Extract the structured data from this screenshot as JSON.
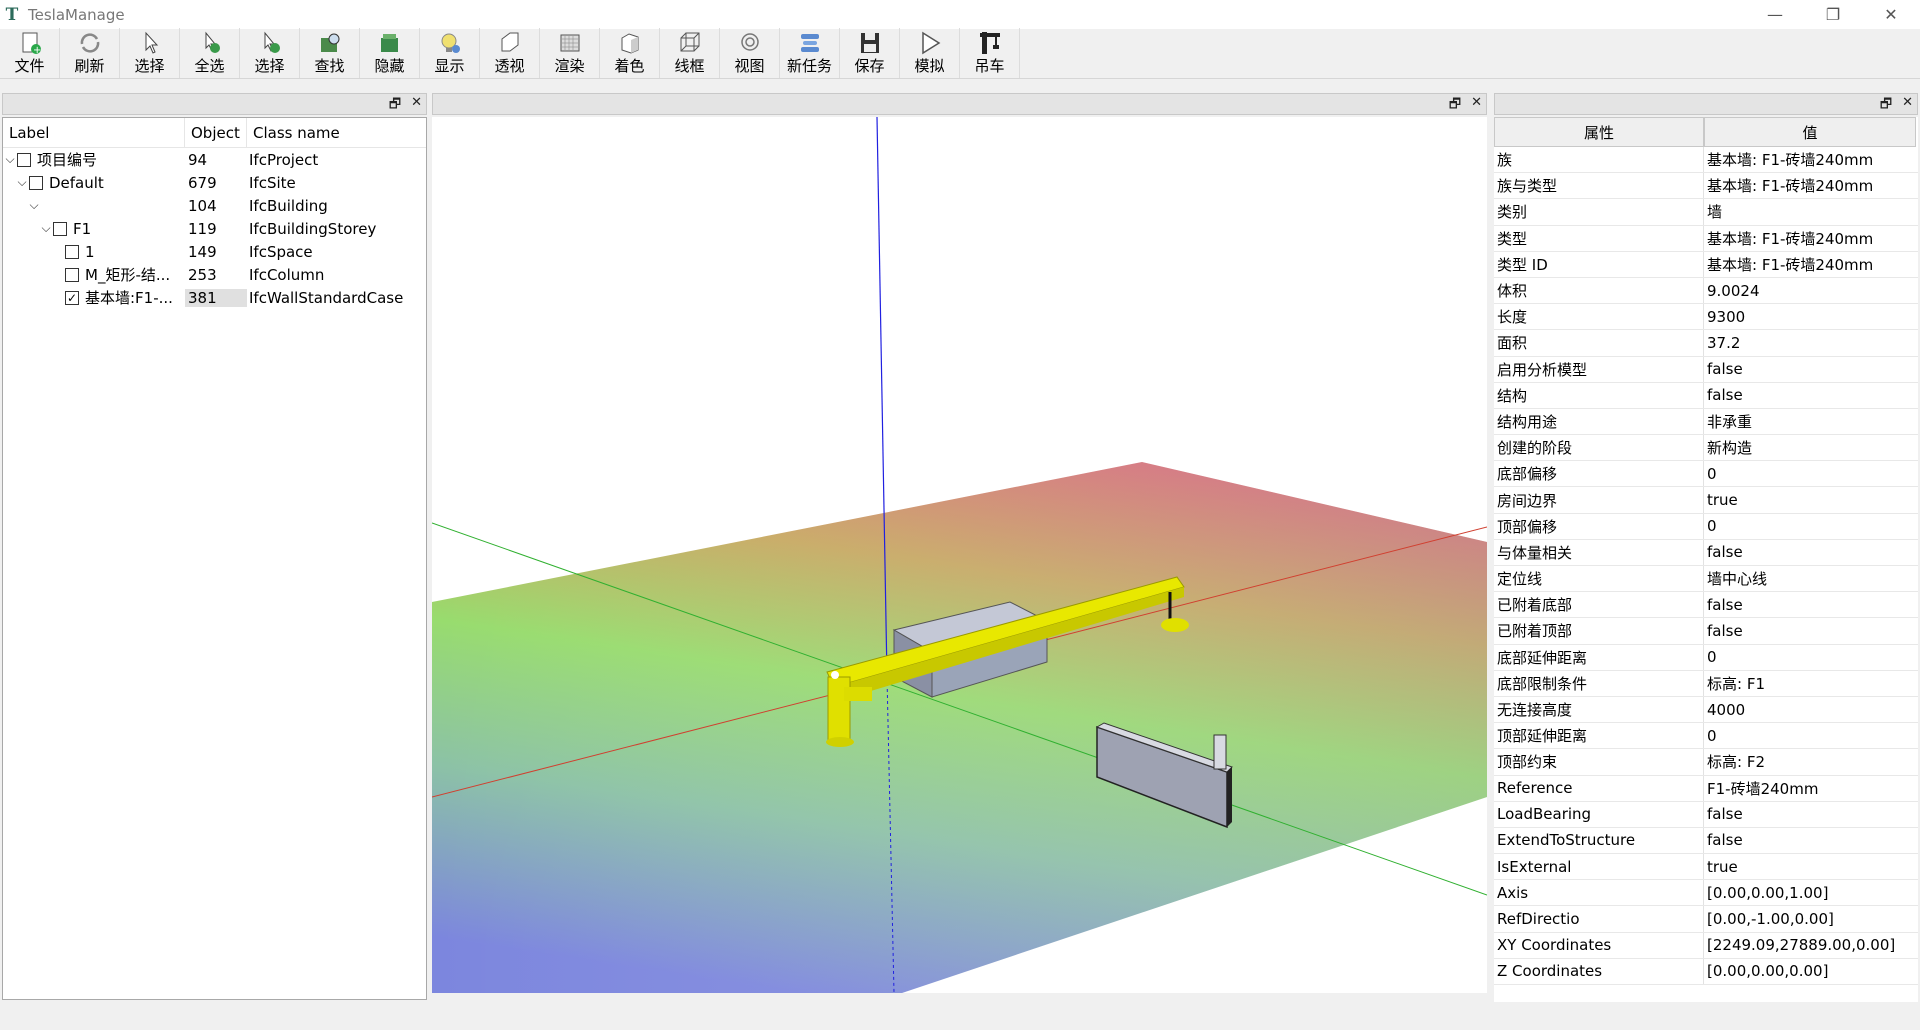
{
  "app": {
    "title": "TeslaManage",
    "logo_letter": "T"
  },
  "window_controls": {
    "minimize": "—",
    "restore": "❐",
    "close": "✕"
  },
  "toolbar": [
    {
      "label": "文件",
      "icon": "new-file-icon"
    },
    {
      "label": "刷新",
      "icon": "refresh-icon"
    },
    {
      "label": "选择",
      "icon": "cursor-icon"
    },
    {
      "label": "全选",
      "icon": "select-all-icon"
    },
    {
      "label": "选择",
      "icon": "select-icon"
    },
    {
      "label": "查找",
      "icon": "find-icon"
    },
    {
      "label": "隐藏",
      "icon": "hide-icon"
    },
    {
      "label": "显示",
      "icon": "show-icon"
    },
    {
      "label": "透视",
      "icon": "perspective-icon"
    },
    {
      "label": "渲染",
      "icon": "render-icon"
    },
    {
      "label": "着色",
      "icon": "shade-icon"
    },
    {
      "label": "线框",
      "icon": "wireframe-icon"
    },
    {
      "label": "视图",
      "icon": "view-icon"
    },
    {
      "label": "新任务",
      "icon": "new-task-icon"
    },
    {
      "label": "保存",
      "icon": "save-icon"
    },
    {
      "label": "模拟",
      "icon": "simulate-icon"
    },
    {
      "label": "吊车",
      "icon": "crane-icon"
    }
  ],
  "dock_buttons": {
    "float": "🗗",
    "close": "✕"
  },
  "tree": {
    "headers": {
      "label": "Label",
      "object": "Object",
      "class": "Class name"
    },
    "rows": [
      {
        "indent": 0,
        "expander": "⌵",
        "checkbox": true,
        "checked": false,
        "label": "项目编号",
        "object": "94",
        "class": "IfcProject"
      },
      {
        "indent": 1,
        "expander": "⌵",
        "checkbox": true,
        "checked": false,
        "label": "Default",
        "object": "679",
        "class": "IfcSite"
      },
      {
        "indent": 2,
        "expander": "⌵",
        "checkbox": false,
        "checked": false,
        "label": "",
        "object": "104",
        "class": "IfcBuilding"
      },
      {
        "indent": 3,
        "expander": "⌵",
        "checkbox": true,
        "checked": false,
        "label": "F1",
        "object": "119",
        "class": "IfcBuildingStorey"
      },
      {
        "indent": 4,
        "expander": "",
        "checkbox": true,
        "checked": false,
        "label": "1",
        "object": "149",
        "class": "IfcSpace"
      },
      {
        "indent": 4,
        "expander": "",
        "checkbox": true,
        "checked": false,
        "label": "M_矩形-结...",
        "object": "253",
        "class": "IfcColumn"
      },
      {
        "indent": 4,
        "expander": "",
        "checkbox": true,
        "checked": true,
        "label": "基本墙:F1-...",
        "object": "381",
        "class": "IfcWallStandardCase",
        "selected": true
      }
    ]
  },
  "properties": {
    "headers": {
      "key": "属性",
      "value": "值"
    },
    "rows": [
      {
        "k": "族",
        "v": "基本墙: F1-砖墙240mm"
      },
      {
        "k": "族与类型",
        "v": "基本墙: F1-砖墙240mm"
      },
      {
        "k": "类别",
        "v": "墙"
      },
      {
        "k": "类型",
        "v": "基本墙: F1-砖墙240mm"
      },
      {
        "k": "类型 ID",
        "v": "基本墙: F1-砖墙240mm"
      },
      {
        "k": "体积",
        "v": "9.0024"
      },
      {
        "k": "长度",
        "v": "9300"
      },
      {
        "k": "面积",
        "v": "37.2"
      },
      {
        "k": "启用分析模型",
        "v": "false"
      },
      {
        "k": "结构",
        "v": "false"
      },
      {
        "k": "结构用途",
        "v": "非承重"
      },
      {
        "k": "创建的阶段",
        "v": "新构造"
      },
      {
        "k": "底部偏移",
        "v": "0"
      },
      {
        "k": "房间边界",
        "v": "true"
      },
      {
        "k": "顶部偏移",
        "v": "0"
      },
      {
        "k": "与体量相关",
        "v": "false"
      },
      {
        "k": "定位线",
        "v": "墙中心线"
      },
      {
        "k": "已附着底部",
        "v": "false"
      },
      {
        "k": "已附着顶部",
        "v": "false"
      },
      {
        "k": "底部延伸距离",
        "v": "0"
      },
      {
        "k": "底部限制条件",
        "v": "标高: F1"
      },
      {
        "k": "无连接高度",
        "v": "4000"
      },
      {
        "k": "顶部延伸距离",
        "v": "0"
      },
      {
        "k": "顶部约束",
        "v": "标高: F2"
      },
      {
        "k": "Reference",
        "v": "F1-砖墙240mm"
      },
      {
        "k": "LoadBearing",
        "v": "false"
      },
      {
        "k": "ExtendToStructure",
        "v": "false"
      },
      {
        "k": "IsExternal",
        "v": "true"
      },
      {
        "k": "Axis",
        "v": "[0.00,0.00,1.00]"
      },
      {
        "k": "RefDirectio",
        "v": "[0.00,-1.00,0.00]"
      },
      {
        "k": "XY Coordinates",
        "v": "[2249.09,27889.00,0.00]"
      },
      {
        "k": "Z Coordinates",
        "v": "[0.00,0.00,0.00]"
      }
    ]
  },
  "colors": {
    "crane_yellow": "#e8e800",
    "axis_x": "#d04030",
    "axis_y": "#30b030",
    "axis_z": "#2020e0",
    "box_fill": "#9aa4b8"
  }
}
